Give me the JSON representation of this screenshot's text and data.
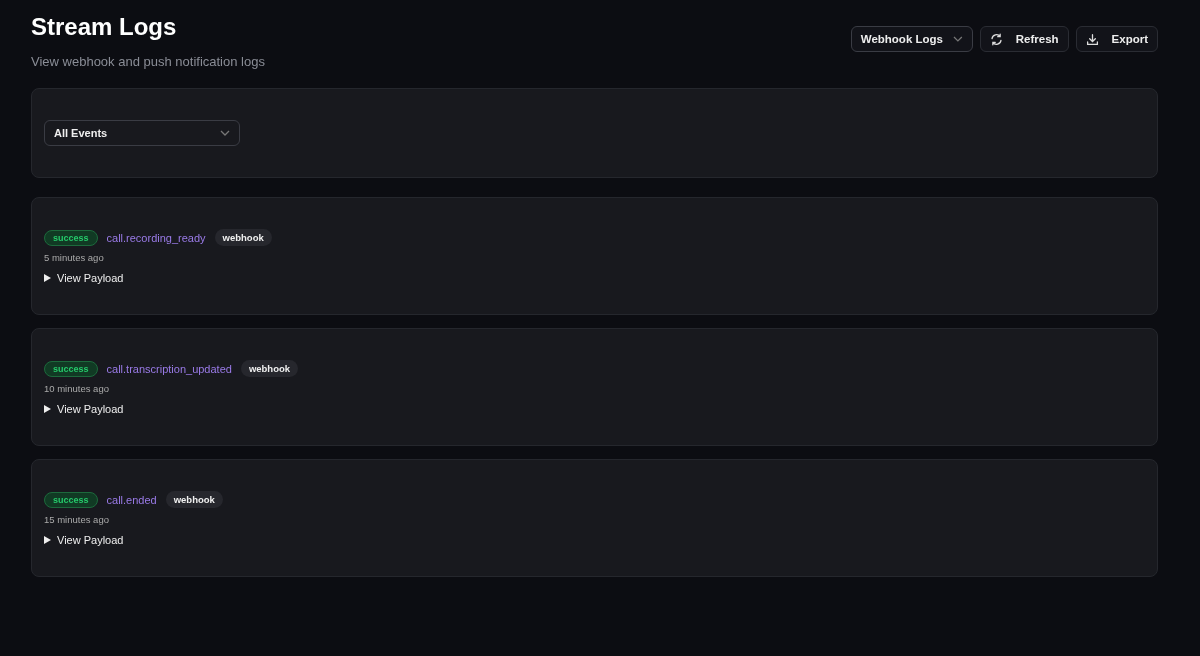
{
  "header": {
    "title": "Stream Logs",
    "subtitle": "View webhook and push notification logs"
  },
  "actions": {
    "log_type": "Webhook Logs",
    "refresh": "Refresh",
    "export": "Export"
  },
  "filter": {
    "event": "All Events"
  },
  "logs": [
    {
      "status": "success",
      "event": "call.recording_ready",
      "channel": "webhook",
      "time": "5 minutes ago",
      "payload_label": "View Payload",
      "expanded": false
    },
    {
      "status": "success",
      "event": "call.transcription_updated",
      "channel": "webhook",
      "time": "10 minutes ago",
      "payload_label": "View Payload",
      "expanded": false
    },
    {
      "status": "success",
      "event": "call.ended",
      "channel": "webhook",
      "time": "15 minutes ago",
      "payload_label": "View Payload",
      "expanded": false
    }
  ]
}
